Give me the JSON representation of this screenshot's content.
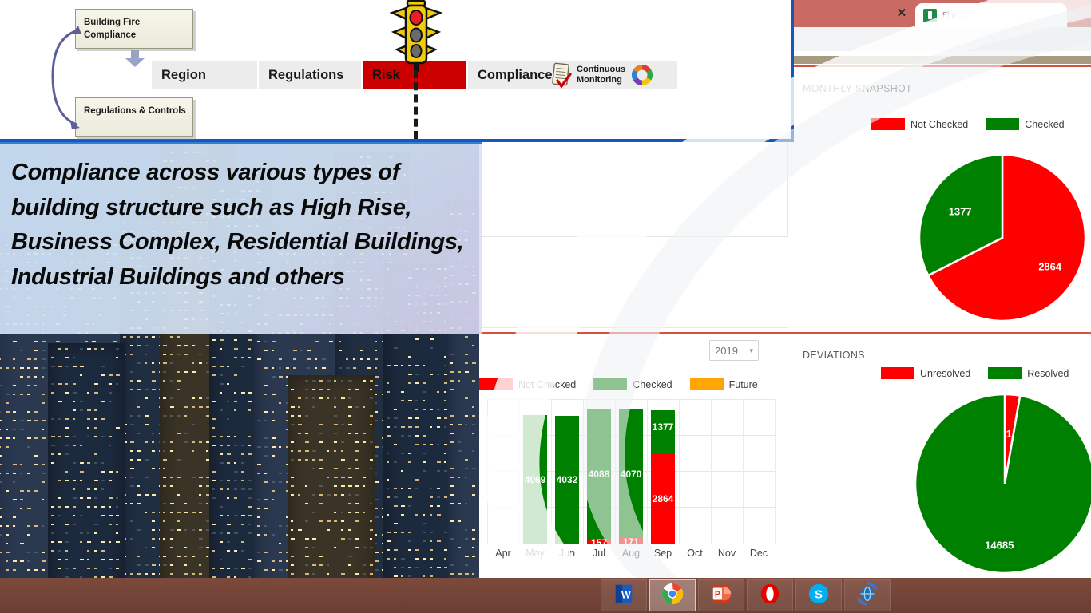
{
  "diagram": {
    "boxes": [
      {
        "label": "Building Fire Compliance"
      },
      {
        "label": "Regulations & Controls"
      }
    ],
    "process_steps": [
      {
        "label": "Region",
        "highlight": false
      },
      {
        "label": "Regulations",
        "highlight": false
      },
      {
        "label": "Risk",
        "highlight": true
      },
      {
        "label": "Compliance",
        "highlight": false
      },
      {
        "label": "Continuous Monitoring",
        "highlight": false
      }
    ],
    "icons": {
      "traffic_light": "traffic-light-icon",
      "clipboard": "clipboard-check-icon",
      "donut": "color-wheel-icon"
    },
    "colors": {
      "risk_red": "#cc0000",
      "panel_border_blue": "#1557bd",
      "box_fill": "#f0eedd"
    }
  },
  "caption": {
    "text": "Compliance across various types of building structure such as High Rise, Business Complex, Residential Buildings, Industrial Buildings and others"
  },
  "browser": {
    "tab": {
      "title": "Fire ...",
      "close_label": "✕",
      "favicon": "spreadsheet-icon"
    }
  },
  "dashboard": {
    "cards": {
      "monthly_snapshot": {
        "title": "MONTHLY SNAPSHOT"
      },
      "deviations": {
        "title": "DEVIATIONS"
      }
    },
    "year_filter": {
      "value": "2019",
      "caret": "▾"
    }
  },
  "chart_data": [
    {
      "type": "bar",
      "title": "",
      "stacked": true,
      "categories": [
        "Apr",
        "May",
        "Jun",
        "Jul",
        "Aug",
        "Sep",
        "Oct",
        "Nov",
        "Dec"
      ],
      "series": [
        {
          "name": "Not Checked",
          "color": "#ff0000",
          "values": [
            null,
            null,
            null,
            157,
            171,
            2864,
            null,
            null,
            null
          ]
        },
        {
          "name": "Checked",
          "color": "#008000",
          "values": [
            null,
            4069,
            4032,
            4088,
            4070,
            1377,
            null,
            null,
            null
          ]
        }
      ],
      "legend": [
        {
          "label": "Not Checked",
          "color": "#ff0000"
        },
        {
          "label": "Checked",
          "color": "#008000"
        },
        {
          "label": "Future",
          "color": "#ffa500"
        }
      ],
      "visible_bars": [
        {
          "month": "Apr",
          "checked": null,
          "not_checked": null,
          "checked_label": "",
          "nc_label": ""
        },
        {
          "month": "May",
          "checked": 4069,
          "not_checked": null,
          "checked_label": "4069",
          "nc_label": ""
        },
        {
          "month": "Jun",
          "checked": 4032,
          "not_checked": null,
          "checked_label": "4032",
          "nc_label": ""
        },
        {
          "month": "Jul",
          "checked": 4088,
          "not_checked": 157,
          "checked_label": "4088",
          "nc_label": "157"
        },
        {
          "month": "Aug",
          "checked": 4070,
          "not_checked": 171,
          "checked_label": "4070",
          "nc_label": "171"
        },
        {
          "month": "Sep",
          "checked": 1377,
          "not_checked": 2864,
          "checked_label": "1377",
          "nc_label": "2864"
        },
        {
          "month": "Oct",
          "checked": null,
          "not_checked": null,
          "checked_label": "",
          "nc_label": ""
        },
        {
          "month": "Nov",
          "checked": null,
          "not_checked": null,
          "checked_label": "",
          "nc_label": ""
        },
        {
          "month": "Dec",
          "checked": null,
          "not_checked": null,
          "checked_label": "",
          "nc_label": ""
        }
      ],
      "xlabel": "",
      "ylabel": "",
      "grid": true,
      "legend_position": "top"
    },
    {
      "type": "pie",
      "title": "MONTHLY SNAPSHOT",
      "labels": [
        "Not Checked",
        "Checked"
      ],
      "values": [
        2864,
        1377
      ],
      "colors": [
        "#ff0000",
        "#008000"
      ],
      "data_labels": [
        "2864",
        "1377"
      ],
      "legend_position": "top"
    },
    {
      "type": "pie",
      "title": "DEVIATIONS",
      "labels": [
        "Unresolved",
        "Resolved"
      ],
      "values": [
        414,
        14685
      ],
      "colors": [
        "#ff0000",
        "#008000"
      ],
      "data_labels": [
        "414",
        "14685"
      ],
      "legend_position": "top"
    }
  ],
  "taskbar": {
    "items": [
      {
        "name": "word-icon",
        "label": "W"
      },
      {
        "name": "chrome-icon",
        "label": ""
      },
      {
        "name": "powerpoint-icon",
        "label": "P"
      },
      {
        "name": "opera-icon",
        "label": "O"
      },
      {
        "name": "skype-icon",
        "label": "S"
      },
      {
        "name": "browser-globe-icon",
        "label": ""
      }
    ]
  }
}
